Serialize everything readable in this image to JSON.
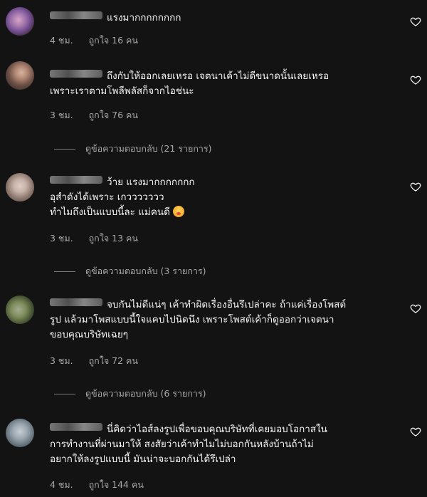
{
  "comments": [
    {
      "text": "แรงมากกกกกกกก",
      "time": "4 ชม.",
      "likes": "ถูกใจ 16 คน",
      "avatar_colors": [
        "#d9a6c8",
        "#6f4a8e",
        "#3b2d33"
      ]
    },
    {
      "text": "ถึงกับให้ออกเลยเหรอ เจตนาเค้าไม่ดีขนาดนั้นเลยเหรอ\nเพราะเราตามโพลีพลัสก็จากไอช่นะ",
      "time": "3 ชม.",
      "likes": "ถูกใจ 76 คน",
      "replies": "ดูข้อความตอบกลับ (21 รายการ)",
      "avatar_colors": [
        "#b58b77",
        "#4a3a35",
        "#8d6e63"
      ]
    },
    {
      "text": "ว้าย แรงมากกกกกกก\nอุสำดังได้เพราะ เกววววววว\nทำไมถึงเป็นแบบนี้ละ แม่คนดี",
      "time": "3 ชม.",
      "likes": "ถูกใจ 13 คน",
      "replies": "ดูข้อความตอบกลับ (3 รายการ)",
      "avatar_colors": [
        "#c7b2a8",
        "#8b776e",
        "#5e4f48"
      ]
    },
    {
      "text": "จบกันไม่ดีแน่ๆ เค้าทำผิดเรื่องอื่นรึเปล่าคะ ถ้าแค่เรื่องโพสต์\nรูป แล้วมาโพสแบบนี้ใจแคบไปนิดนึง เพราะโพสต์เค้าก็ดูออกว่าเจตนา\nขอบคุณบริษัทเฉยๆ",
      "time": "3 ชม.",
      "likes": "ถูกใจ 72 คน",
      "replies": "ดูข้อความตอบกลับ (6 รายการ)",
      "avatar_colors": [
        "#7d8c5a",
        "#3e4a2e",
        "#a5ab90"
      ]
    },
    {
      "text": "นี่คิดว่าไอส์ลงรูปเพื่อขอบคุณบริษัทที่เคยมอบโอกาสใน\nการทำงานที่ผ่านมาให้ สงสัยว่าเค้าทำไมไม่บอกกันหลังบ้านถ้าไม่\nอยากให้ลงรูปแบบนี้ มันน่าจะบอกกันได้รึเปล่า",
      "time": "4 ชม.",
      "likes": "ถูกใจ 144 คน",
      "avatar_colors": [
        "#9aa6b0",
        "#5d6a73",
        "#c8cfd4"
      ]
    }
  ]
}
